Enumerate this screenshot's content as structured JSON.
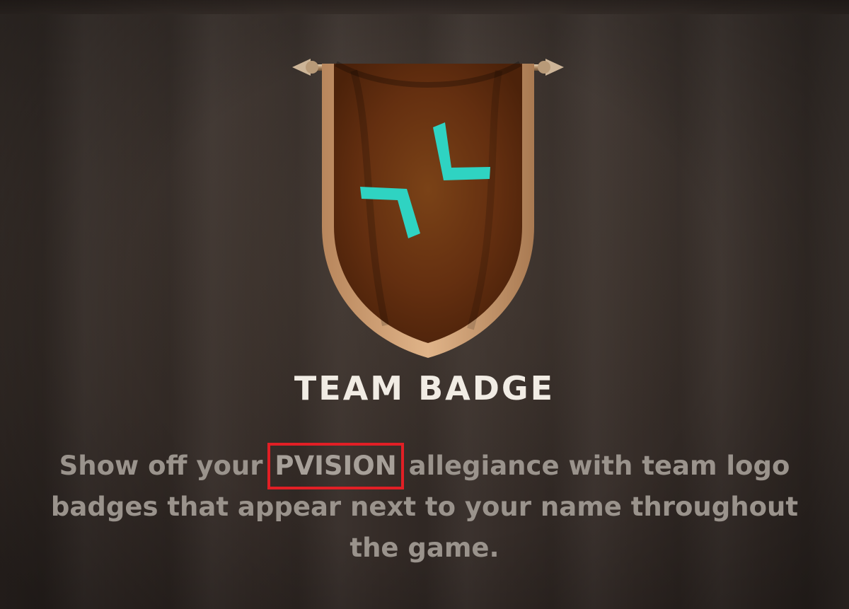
{
  "reward": {
    "title": "TEAM BADGE",
    "description_before": "Show off your",
    "team_name": "PVISION",
    "description_after": "allegiance with team logo badges that appear next to your name throughout the game.",
    "highlight_color": "#e11f25",
    "logo_color": "#2fd3c2",
    "banner_color": "#6b3613",
    "banner_trim_color": "#d7a677",
    "icon": "team-logo-icon"
  }
}
